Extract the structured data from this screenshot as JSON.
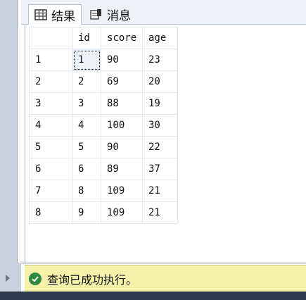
{
  "tabs": [
    {
      "label": "结果",
      "icon": "grid-icon",
      "active": true
    },
    {
      "label": "消息",
      "icon": "messages-icon",
      "active": false
    }
  ],
  "grid": {
    "columns": [
      "",
      "id",
      "score",
      "age"
    ],
    "rows": [
      {
        "n": "1",
        "id": "1",
        "score": "90",
        "age": "23"
      },
      {
        "n": "2",
        "id": "2",
        "score": "69",
        "age": "20"
      },
      {
        "n": "3",
        "id": "3",
        "score": "88",
        "age": "19"
      },
      {
        "n": "4",
        "id": "4",
        "score": "100",
        "age": "30"
      },
      {
        "n": "5",
        "id": "5",
        "score": "90",
        "age": "22"
      },
      {
        "n": "6",
        "id": "6",
        "score": "89",
        "age": "37"
      },
      {
        "n": "7",
        "id": "8",
        "score": "109",
        "age": "21"
      },
      {
        "n": "8",
        "id": "9",
        "score": "109",
        "age": "21"
      }
    ]
  },
  "status": {
    "text": "查询已成功执行。",
    "icon": "check-circle-icon",
    "color": "#f7f2a9"
  }
}
